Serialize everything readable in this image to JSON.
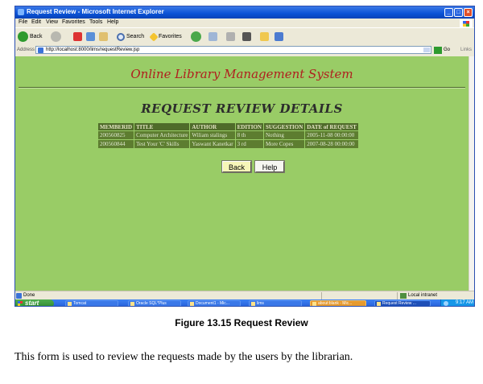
{
  "window": {
    "title": "Request Review - Microsoft Internet Explorer",
    "minimize": "_",
    "maximize": "□",
    "close": "×"
  },
  "menu": [
    "File",
    "Edit",
    "View",
    "Favorites",
    "Tools",
    "Help"
  ],
  "toolbar": {
    "back_label": "Back",
    "search_label": "Search",
    "favorites_label": "Favorites"
  },
  "address": {
    "label": "Address",
    "url": "http://localhost:8000/lims/requestReview.jsp",
    "go_label": "Go",
    "links_label": "Links"
  },
  "page": {
    "system_name": "Online Library Management System",
    "heading": "REQUEST REVIEW DETAILS",
    "table": {
      "headers": [
        "MEMBERID",
        "TITLE",
        "AUTHOR",
        "EDITION",
        "SUGGESTION",
        "DATE of REQUEST"
      ],
      "rows": [
        [
          "200560825",
          "Computer Architecture",
          "Wiliam stalings",
          "8 th",
          "Nothing",
          "2005-11-08 00:00:00"
        ],
        [
          "200560844",
          "Test Your 'C' Skills",
          "Yaswant Kanetkar",
          "3 rd",
          "More Copes",
          "2007-08-28 00:00:00"
        ]
      ]
    },
    "buttons": {
      "back": "Back",
      "help": "Help"
    }
  },
  "status": {
    "text": "Done",
    "zone": "Local intranet"
  },
  "taskbar": {
    "start": "start",
    "tasks": [
      "Tomcat",
      "Oracle SQL*Plus",
      "Document1 - Mic...",
      "lims",
      "about:blank - Mic...",
      "Request Review ..."
    ],
    "clock": "9:17 AM"
  },
  "figure_caption": "Figure 13.15 Request Review",
  "description": "This form is used to review the requests made by the users by the librarian."
}
